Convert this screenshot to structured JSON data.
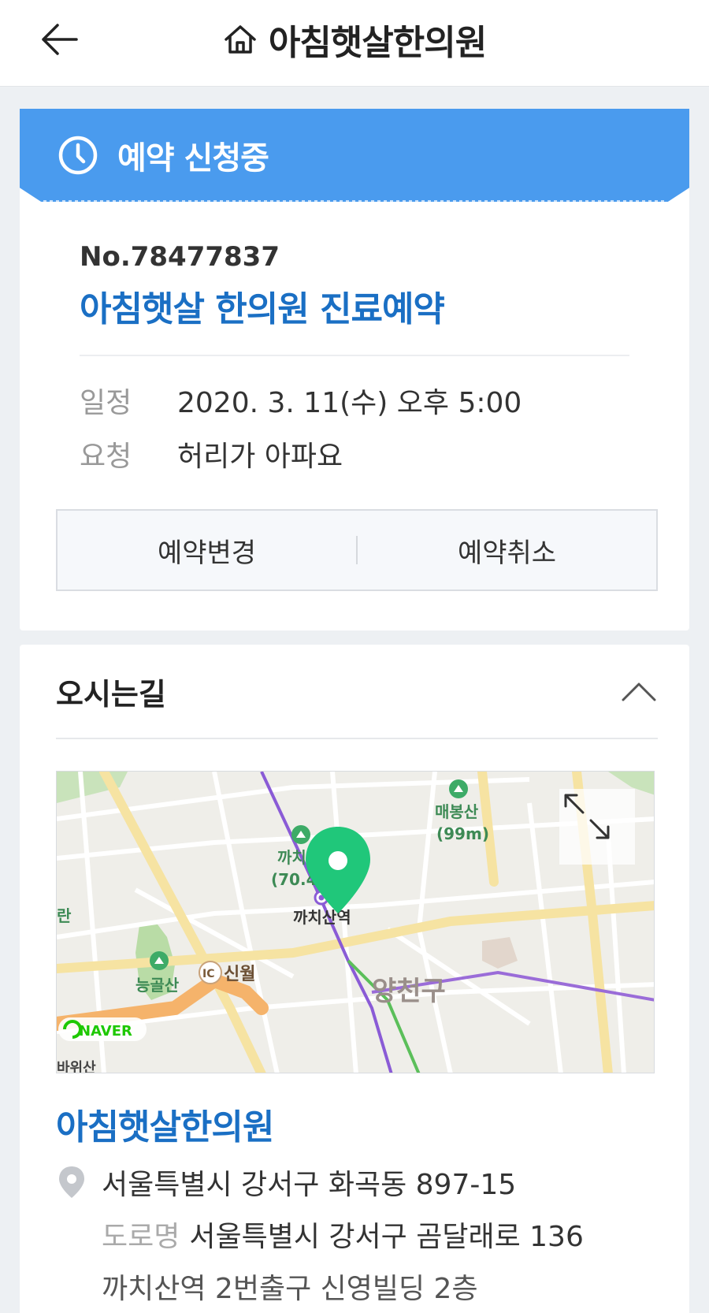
{
  "header": {
    "back_icon": "arrow-left-icon",
    "home_icon": "home-icon",
    "title": "아침햇살한의원"
  },
  "reservation": {
    "status_icon": "clock-icon",
    "status": "예약 신청중",
    "number": "No.78477837",
    "title": "아침햇살 한의원 진료예약",
    "schedule_label": "일정",
    "schedule_value": "2020. 3. 11(수) 오후 5:00",
    "request_label": "요청",
    "request_value": "허리가 아파요",
    "change_button": "예약변경",
    "cancel_button": "예약취소"
  },
  "directions": {
    "title": "오시는길",
    "collapse_icon": "chevron-up-icon",
    "map": {
      "expand_icon": "expand-arrows-icon",
      "marker_icon": "map-pin-icon",
      "labels": {
        "mountain_1": "매봉산",
        "mountain_1_height": "(99m)",
        "mountain_2": "까치",
        "mountain_2_height": "(70.4",
        "station": "까치산역",
        "district": "양천구",
        "ic": "IC",
        "sinwol": "신월",
        "mountain_3": "능골산",
        "provider": "NAVER",
        "edge_label": "바위산",
        "edge_left": "란"
      }
    },
    "clinic_name": "아침햇살한의원",
    "address_icon": "location-pin-icon",
    "address": "서울특별시 강서구 화곡동 897-15",
    "road_label": "도로명",
    "road_address": "서울특별시 강서구 곰달래로 136",
    "detail": "까치산역 2번출구 신영빌딩 2층"
  },
  "colors": {
    "accent_blue": "#4a9bee",
    "link_blue": "#1a6fc4",
    "marker_green": "#20c77a"
  }
}
